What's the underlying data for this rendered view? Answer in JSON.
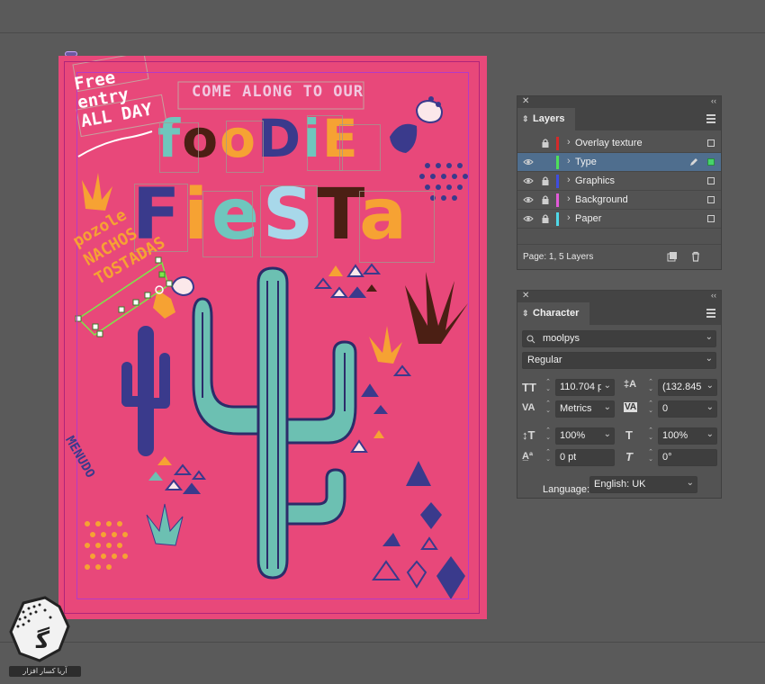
{
  "poster": {
    "free_entry_lines": [
      "Free",
      "entry",
      "ALL DAY"
    ],
    "come_along": "COME ALONG TO OUR",
    "foodie": [
      {
        "ch": "f",
        "color": "#6fc6bd"
      },
      {
        "ch": "o",
        "color": "#4b1f14"
      },
      {
        "ch": "o",
        "color": "#f6a233"
      },
      {
        "ch": "D",
        "color": "#3a3a8c"
      },
      {
        "ch": "i",
        "color": "#6fc6bd"
      },
      {
        "ch": "E",
        "color": "#f6a233"
      }
    ],
    "fiesta": [
      {
        "ch": "F",
        "color": "#3a3a8c"
      },
      {
        "ch": "i",
        "color": "#f6a233"
      },
      {
        "ch": "e",
        "color": "#6fc6bd"
      },
      {
        "ch": "S",
        "color": "#a8d8ea"
      },
      {
        "ch": "T",
        "color": "#4b1f14"
      },
      {
        "ch": "a",
        "color": "#f6a233"
      }
    ],
    "menu_lines": [
      "pozole",
      "NACHOS",
      "TOSTADAS"
    ],
    "menudo": "MENUDO"
  },
  "layers_panel": {
    "tab": "Layers",
    "layers": [
      {
        "name": "Overlay texture",
        "color": "#d42a2a",
        "eye": false,
        "lock": true,
        "selected": false,
        "pen": false
      },
      {
        "name": "Type",
        "color": "#4ee05a",
        "eye": true,
        "lock": false,
        "selected": true,
        "pen": true
      },
      {
        "name": "Graphics",
        "color": "#3f4de0",
        "eye": true,
        "lock": true,
        "selected": false,
        "pen": false
      },
      {
        "name": "Background",
        "color": "#e25ad8",
        "eye": true,
        "lock": true,
        "selected": false,
        "pen": false
      },
      {
        "name": "Paper",
        "color": "#4fd8e8",
        "eye": true,
        "lock": true,
        "selected": false,
        "pen": false
      }
    ],
    "footer": "Page: 1, 5 Layers"
  },
  "character_panel": {
    "tab": "Character",
    "font_family": "moolpys",
    "font_style": "Regular",
    "font_size": "110.704 p",
    "leading": "(132.845",
    "kerning": "Metrics",
    "tracking": "0",
    "vertical_scale": "100%",
    "horizontal_scale": "100%",
    "baseline_shift": "0 pt",
    "skew": "0°",
    "language_label": "Language:",
    "language": "English: UK"
  },
  "watermark": "آریا کسار افزار"
}
